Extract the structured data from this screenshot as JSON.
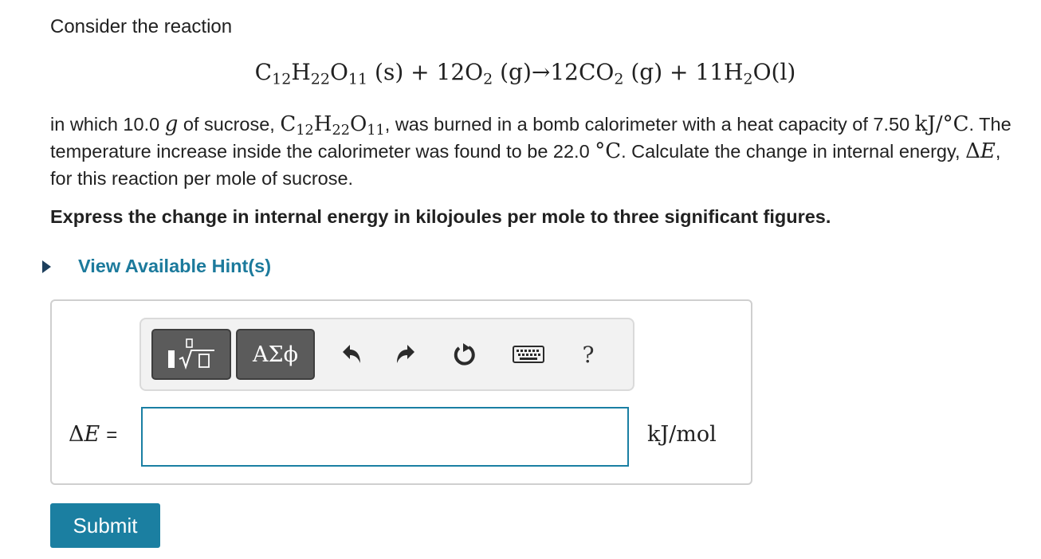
{
  "problem": {
    "intro": "Consider the reaction",
    "equation": {
      "p1": "C",
      "s1": "12",
      "p2": "H",
      "s2": "22",
      "p3": "O",
      "s3": "11",
      "p4": " (s) + 12O",
      "s4": "2",
      "p5": " (g)→12CO",
      "s5": "2",
      "p6": " (g) + 11H",
      "s6": "2",
      "p7": "O(l)"
    },
    "paragraph": {
      "t1": "in which 10.0 ",
      "g1": "g",
      "t2": " of sucrose, ",
      "f1": "C",
      "fs1": "12",
      "f2": "H",
      "fs2": "22",
      "f3": "O",
      "fs3": "11",
      "t3": ", was burned in a bomb calorimeter with a heat capacity of 7.50 ",
      "u1": "kJ/°C",
      "t4": ". The temperature increase inside the calorimeter was found to be 22.0 ",
      "u2": "°C",
      "t5": ". Calculate the change in internal energy, ",
      "delta": "Δ",
      "e": "E",
      "t6": ", for this reaction per mole of sucrose."
    },
    "instruction": "Express the change in internal energy in kilojoules per mole to three significant figures.",
    "hint_link": "View Available Hint(s)"
  },
  "toolbar": {
    "greek_label": "ΑΣϕ",
    "help_label": "?",
    "icons": [
      "templates-icon",
      "greek-icon",
      "undo-icon",
      "redo-icon",
      "reset-icon",
      "keyboard-icon",
      "help-icon"
    ]
  },
  "answer": {
    "label_symbol": "Δ",
    "label_var": "E",
    "label_equals": "=",
    "value": "",
    "units": "kJ/mol"
  },
  "submit_label": "Submit",
  "colors": {
    "accent": "#1b7fa1",
    "link": "#1c7a9c",
    "toolbar_button": "#5b5b5b",
    "input_border": "#1a7fa3"
  }
}
